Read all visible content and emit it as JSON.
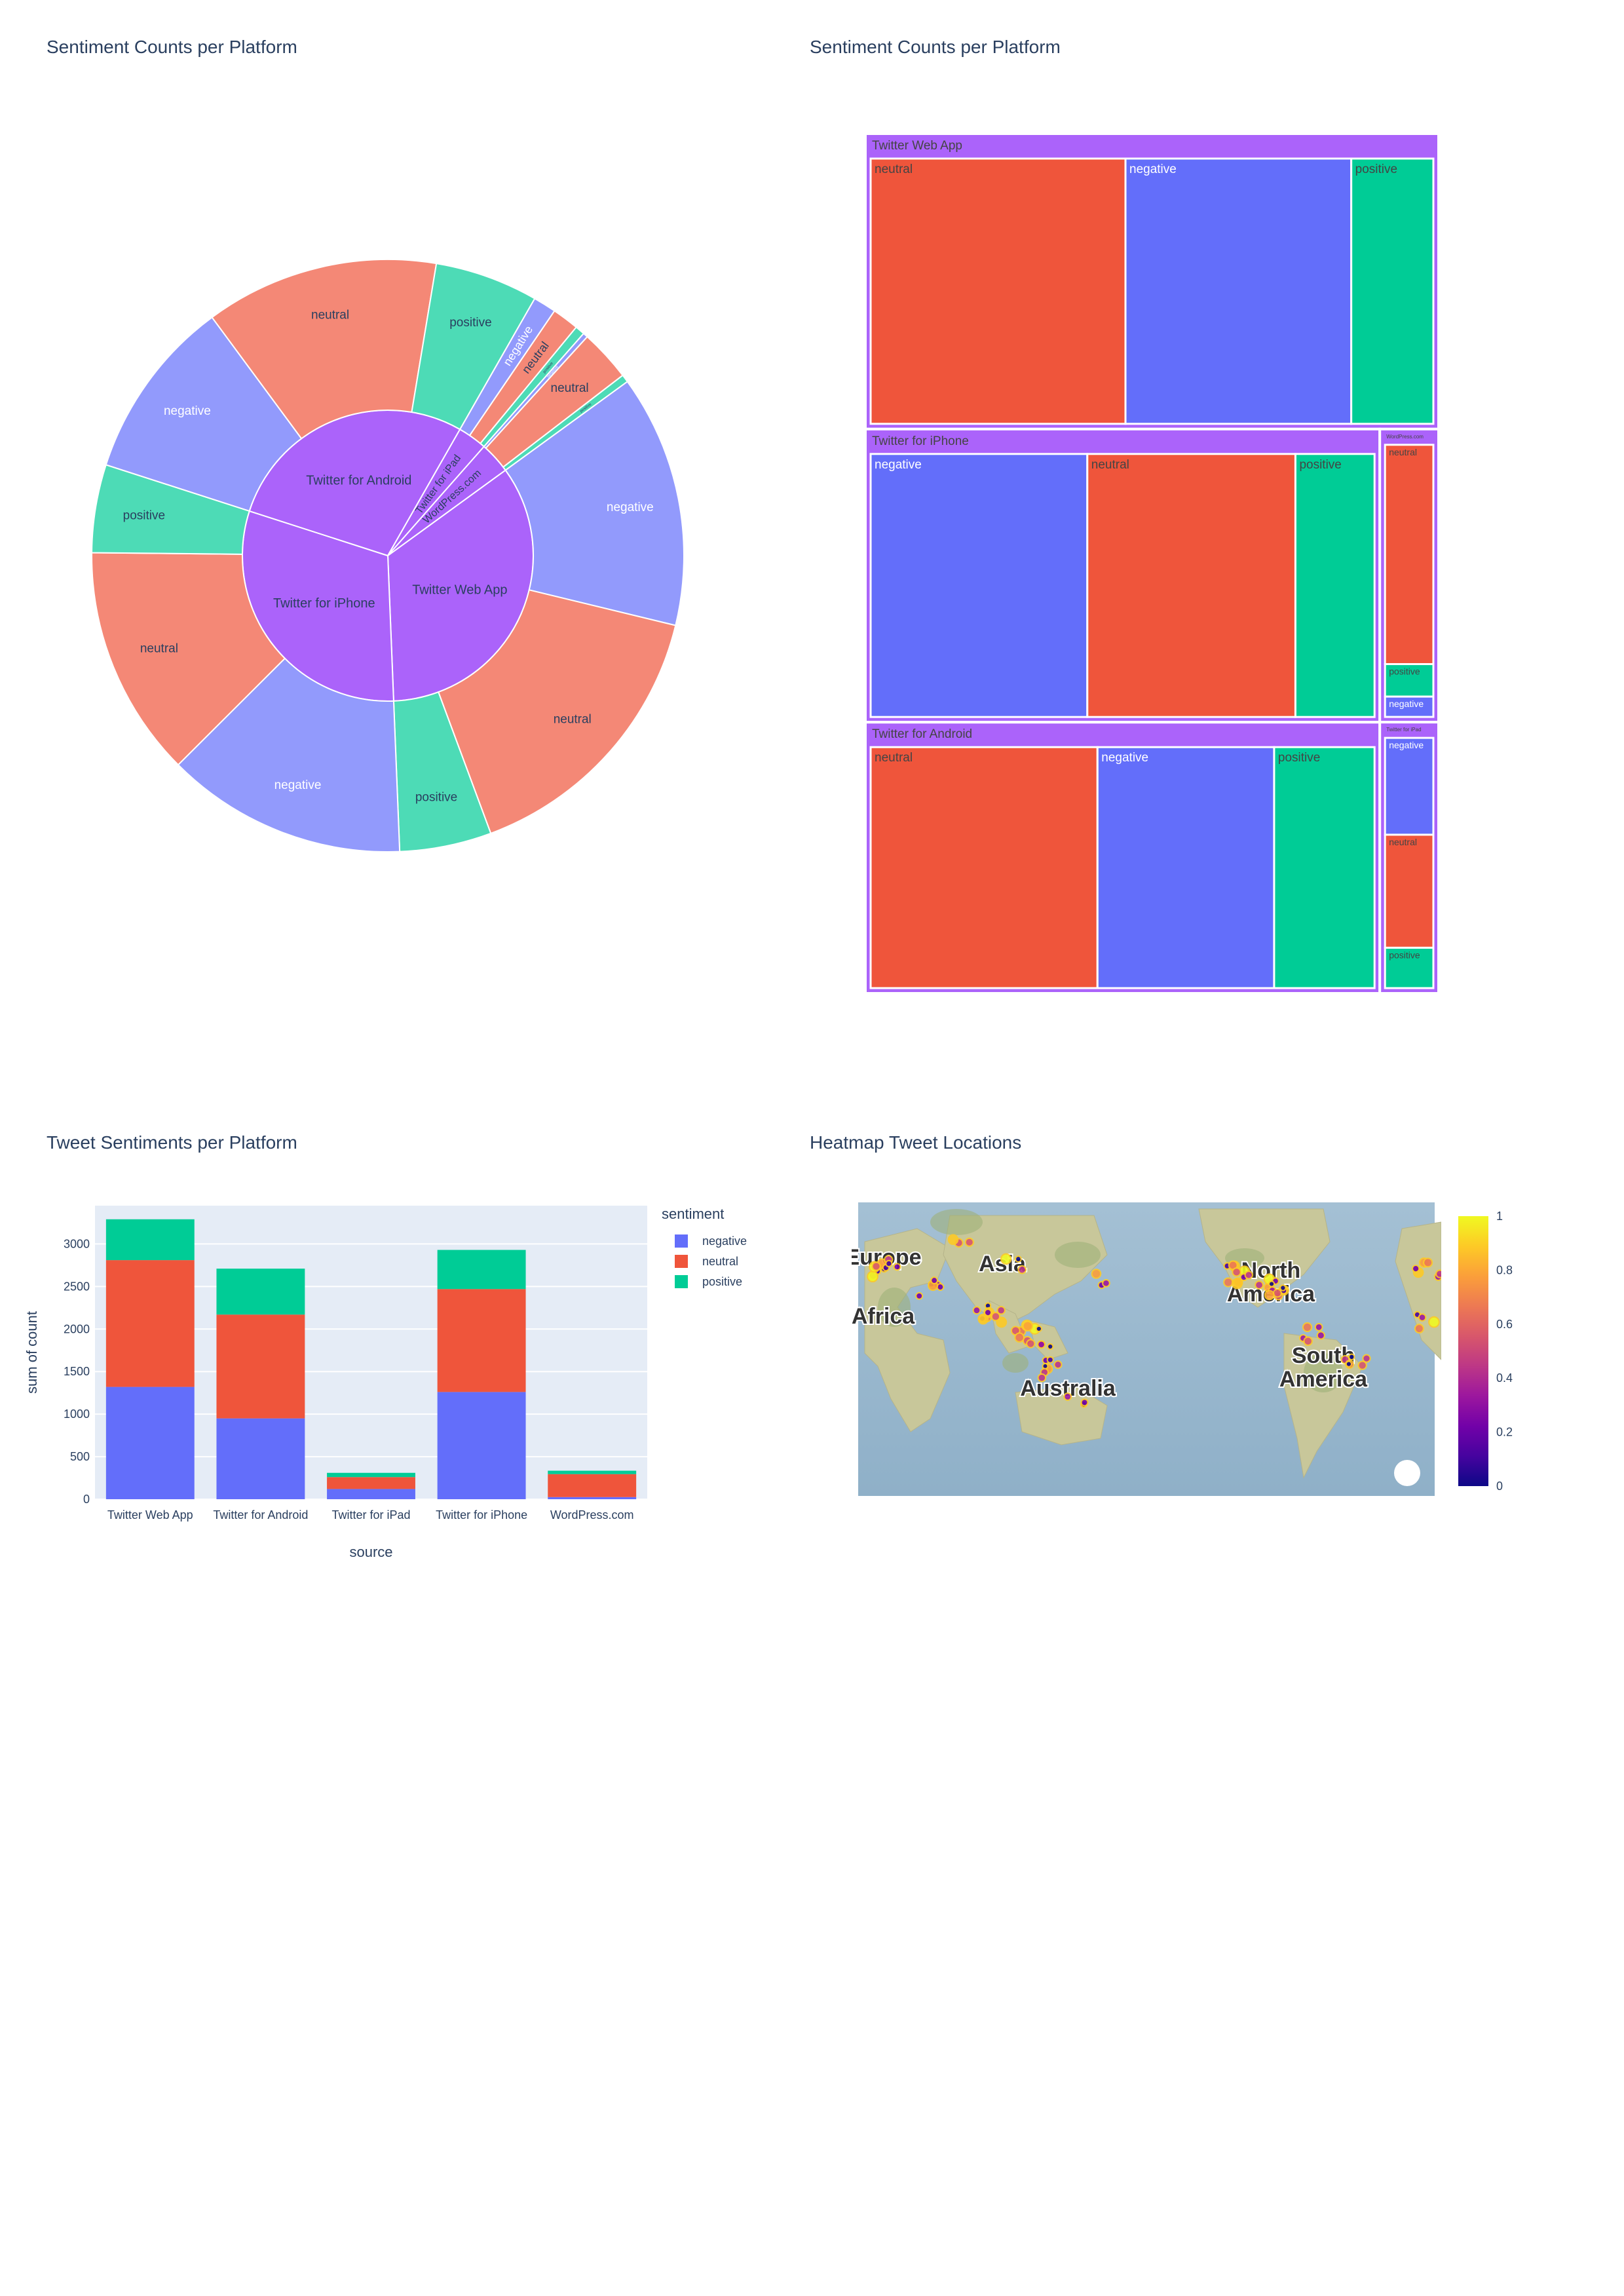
{
  "colors": {
    "negative": "#636efa",
    "neutral": "#ef553b",
    "positive": "#00cc96",
    "parent": "#ab63fa",
    "plot_bg": "#e5ecf6",
    "text": "#2a3f5f",
    "colorscale": [
      "#0d0887",
      "#46039f",
      "#7201a8",
      "#9c179e",
      "#bd3786",
      "#d8576b",
      "#ed7953",
      "#fb9f3a",
      "#fdca26",
      "#f0f921"
    ]
  },
  "sunburst": {
    "title": "Sentiment Counts per Platform"
  },
  "treemap": {
    "title": "Sentiment Counts per Platform"
  },
  "bar": {
    "title": "Tweet Sentiments per Platform",
    "xlabel": "source",
    "ylabel": "sum of count",
    "legend_title": "sentiment"
  },
  "map": {
    "title": "Heatmap Tweet Locations",
    "labels": [
      "Europe",
      "Asia",
      "Africa",
      "North America",
      "South America",
      "Australia"
    ],
    "colorbar_ticks": [
      "0",
      "0.2",
      "0.4",
      "0.6",
      "0.8",
      "1"
    ]
  },
  "chart_data": [
    {
      "type": "sunburst",
      "title": "Sentiment Counts per Platform",
      "parents": [
        "Twitter Web App",
        "Twitter for iPhone",
        "Twitter for Android",
        "Twitter for iPad",
        "WordPress.com"
      ],
      "children": {
        "Twitter Web App": [
          {
            "label": "negative",
            "value": 1320
          },
          {
            "label": "neutral",
            "value": 1490
          },
          {
            "label": "positive",
            "value": 480
          }
        ],
        "Twitter for iPhone": [
          {
            "label": "negative",
            "value": 1260
          },
          {
            "label": "neutral",
            "value": 1210
          },
          {
            "label": "positive",
            "value": 460
          }
        ],
        "Twitter for Android": [
          {
            "label": "negative",
            "value": 950
          },
          {
            "label": "neutral",
            "value": 1220
          },
          {
            "label": "positive",
            "value": 540
          }
        ],
        "Twitter for iPad": [
          {
            "label": "negative",
            "value": 120
          },
          {
            "label": "neutral",
            "value": 140
          },
          {
            "label": "positive",
            "value": 50
          }
        ],
        "WordPress.com": [
          {
            "label": "negative",
            "value": 25
          },
          {
            "label": "neutral",
            "value": 270
          },
          {
            "label": "positive",
            "value": 40
          }
        ]
      }
    },
    {
      "type": "treemap",
      "title": "Sentiment Counts per Platform",
      "parents": [
        "Twitter Web App",
        "Twitter for iPhone",
        "Twitter for Android",
        "WordPress.com",
        "Twitter for iPad"
      ],
      "children": {
        "Twitter Web App": [
          {
            "label": "neutral",
            "value": 1490
          },
          {
            "label": "negative",
            "value": 1320
          },
          {
            "label": "positive",
            "value": 480
          }
        ],
        "Twitter for iPhone": [
          {
            "label": "negative",
            "value": 1260
          },
          {
            "label": "neutral",
            "value": 1210
          },
          {
            "label": "positive",
            "value": 460
          }
        ],
        "Twitter for Android": [
          {
            "label": "neutral",
            "value": 1220
          },
          {
            "label": "negative",
            "value": 950
          },
          {
            "label": "positive",
            "value": 540
          }
        ],
        "WordPress.com": [
          {
            "label": "neutral",
            "value": 270
          },
          {
            "label": "positive",
            "value": 40
          },
          {
            "label": "negative",
            "value": 25
          }
        ],
        "Twitter for iPad": [
          {
            "label": "negative",
            "value": 120
          },
          {
            "label": "neutral",
            "value": 140
          },
          {
            "label": "positive",
            "value": 50
          }
        ]
      }
    },
    {
      "type": "bar",
      "title": "Tweet Sentiments per Platform",
      "categories": [
        "Twitter Web App",
        "Twitter for Android",
        "Twitter for iPad",
        "Twitter for iPhone",
        "WordPress.com"
      ],
      "series": [
        {
          "name": "negative",
          "values": [
            1320,
            950,
            120,
            1260,
            25
          ]
        },
        {
          "name": "neutral",
          "values": [
            1490,
            1220,
            140,
            1210,
            270
          ]
        },
        {
          "name": "positive",
          "values": [
            480,
            540,
            50,
            460,
            40
          ]
        }
      ],
      "xlabel": "source",
      "ylabel": "sum of count",
      "ylim": [
        0,
        3450
      ],
      "yticks": [
        0,
        500,
        1000,
        1500,
        2000,
        2500,
        3000
      ],
      "legend": "top-right",
      "stacked": true
    },
    {
      "type": "heatmap",
      "title": "Heatmap Tweet Locations",
      "colorscale_range": [
        0,
        1
      ],
      "colorbar_ticks": [
        0,
        0.2,
        0.4,
        0.6,
        0.8,
        1
      ]
    }
  ]
}
